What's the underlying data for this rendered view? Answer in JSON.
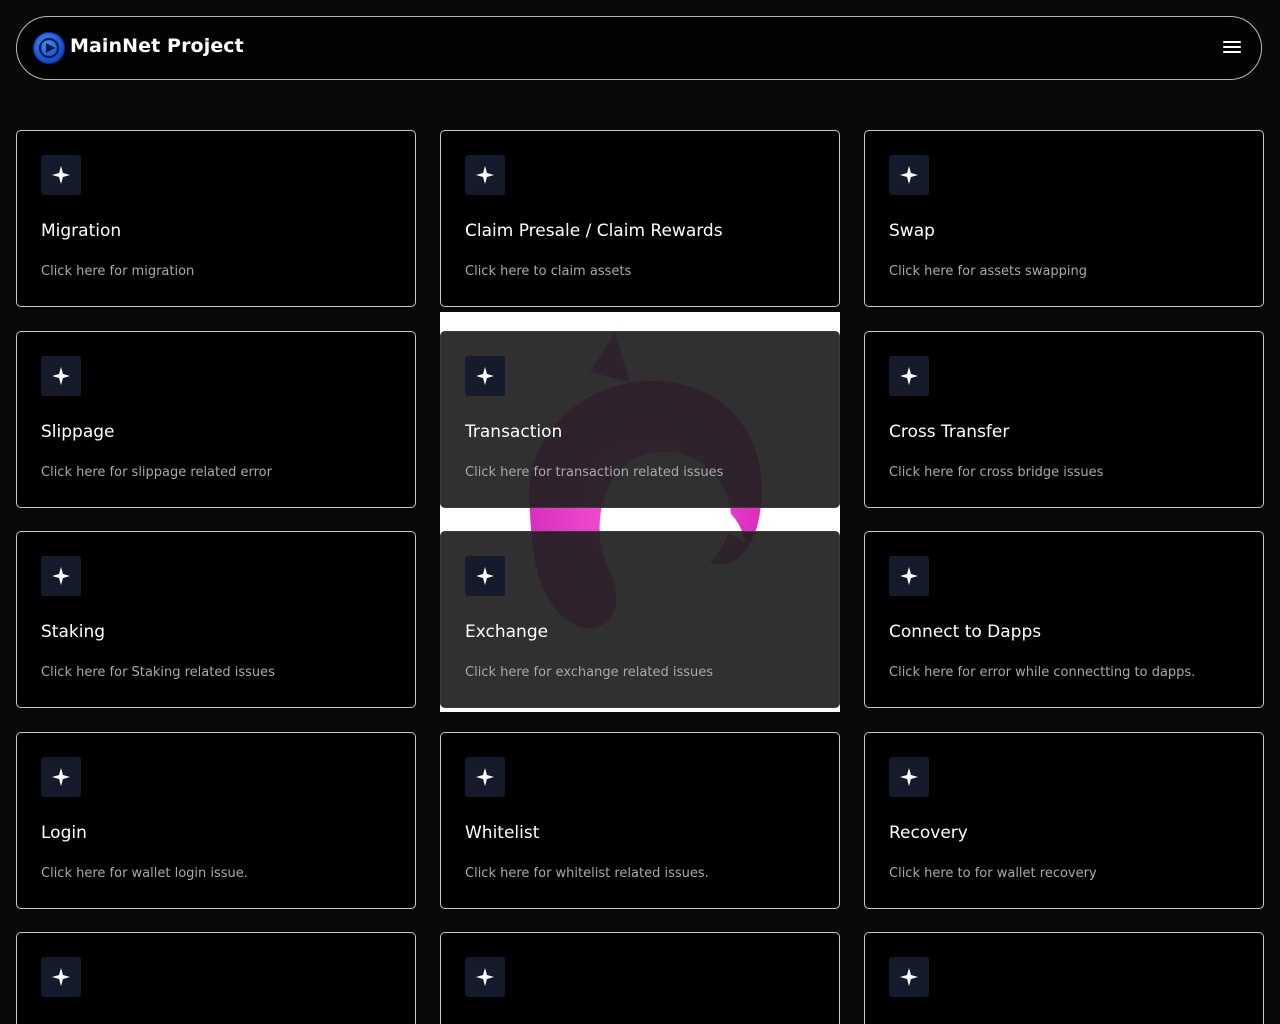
{
  "header": {
    "brand": "MainNet Project",
    "logo_icon": "play-circle-icon",
    "menu_icon": "hamburger-menu-icon"
  },
  "colors": {
    "background": "#0a080a",
    "card_bg": "#000000",
    "card_border": "#c9c9c9",
    "icon_tile": "#151b2b",
    "logo_blue": "#1450d6",
    "accent_magenta": "#e040c8"
  },
  "cards": [
    {
      "title": "Migration",
      "desc": "Click here for migration",
      "icon": "sparkle-icon"
    },
    {
      "title": "Claim Presale / Claim Rewards",
      "desc": "Click here to claim assets",
      "icon": "sparkle-icon"
    },
    {
      "title": "Swap",
      "desc": "Click here for assets swapping",
      "icon": "sparkle-icon"
    },
    {
      "title": "Slippage",
      "desc": "Click here for slippage related error",
      "icon": "sparkle-icon"
    },
    {
      "title": "Transaction",
      "desc": "Click here for transaction related issues",
      "icon": "sparkle-icon"
    },
    {
      "title": "Cross Transfer",
      "desc": "Click here for cross bridge issues",
      "icon": "sparkle-icon"
    },
    {
      "title": "Staking",
      "desc": "Click here for Staking related issues",
      "icon": "sparkle-icon"
    },
    {
      "title": "Exchange",
      "desc": "Click here for exchange related issues",
      "icon": "sparkle-icon"
    },
    {
      "title": "Connect to Dapps",
      "desc": "Click here for error while connectting to dapps.",
      "icon": "sparkle-icon"
    },
    {
      "title": "Login",
      "desc": "Click here for wallet login issue.",
      "icon": "sparkle-icon"
    },
    {
      "title": "Whitelist",
      "desc": "Click here for whitelist related issues.",
      "icon": "sparkle-icon"
    },
    {
      "title": "Recovery",
      "desc": "Click here to for wallet recovery",
      "icon": "sparkle-icon"
    },
    {
      "title": "",
      "desc": "",
      "icon": "sparkle-icon"
    },
    {
      "title": "",
      "desc": "",
      "icon": "sparkle-icon"
    },
    {
      "title": "",
      "desc": "",
      "icon": "sparkle-icon"
    }
  ]
}
